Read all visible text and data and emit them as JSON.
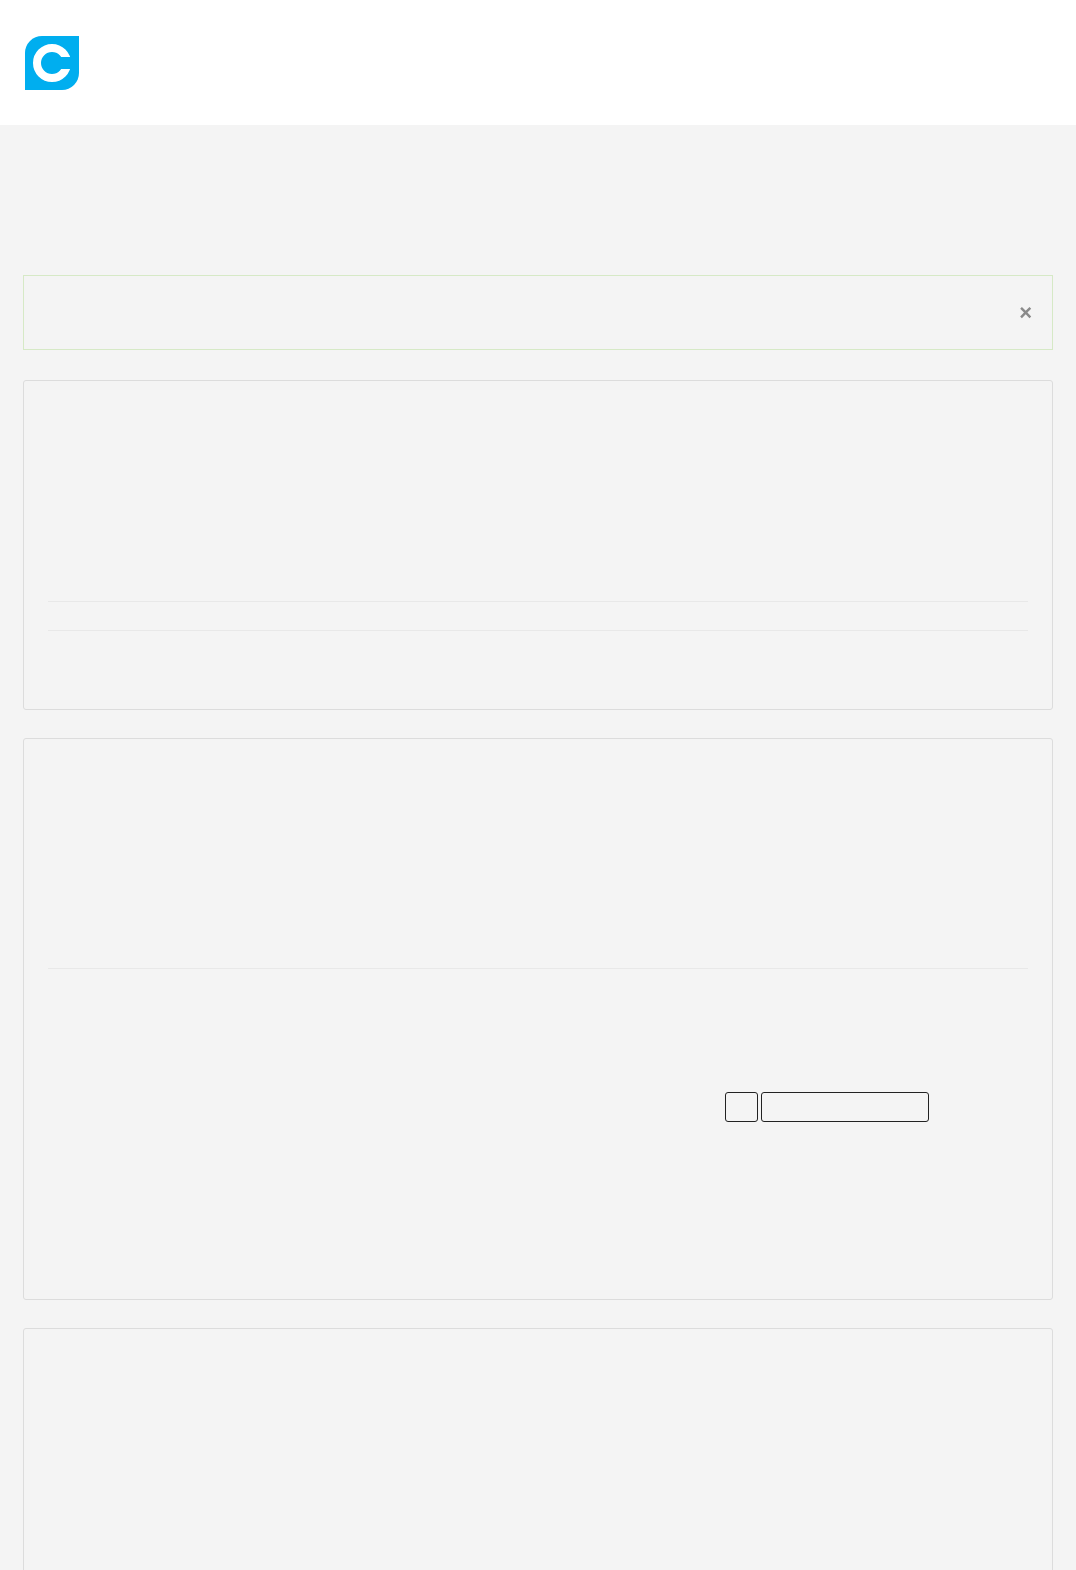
{
  "alert": {
    "close": "×"
  },
  "form": {
    "inputs": [
      {
        "kind": "short"
      },
      {
        "kind": "long"
      }
    ]
  }
}
